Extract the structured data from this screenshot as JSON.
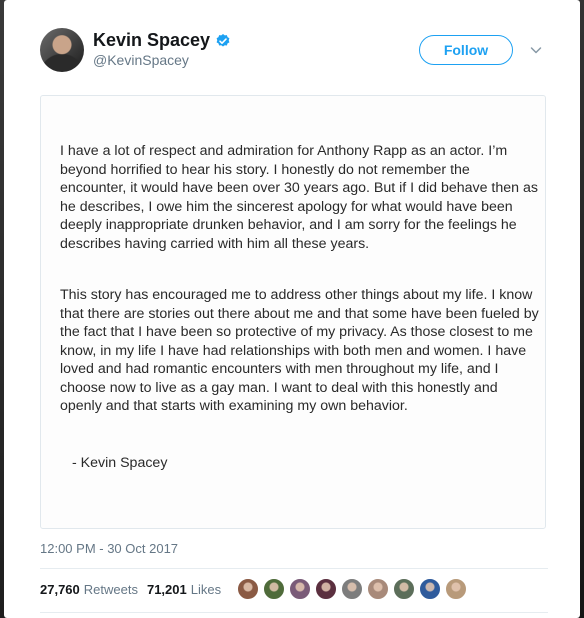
{
  "header": {
    "display_name": "Kevin Spacey",
    "handle": "@KevinSpacey",
    "follow_label": "Follow"
  },
  "statement": {
    "paragraph_1": "I have a lot of respect and admiration for Anthony Rapp as an actor. I’m beyond horrified to hear his story. I honestly do not remember the encounter, it would have been over 30 years ago. But if I did behave then as he describes, I owe him the sincerest apology for what would have been deeply inappropriate drunken behavior, and I am sorry for the feelings he describes having carried with him all these years.",
    "paragraph_2": "This story has encouraged me to address other things about my life. I know that there are stories out there about me and that some have been fueled by the fact that I have been so protective of my privacy. As those closest to me know, in my life I have had relationships with both men and women. I have loved and had romantic encounters with men throughout my life, and I choose now to live as a gay man.  I want to deal with this honestly and openly and that starts with examining my own behavior.",
    "signature": "- Kevin Spacey"
  },
  "meta": {
    "timestamp": "12:00 PM - 30 Oct 2017",
    "retweets_count": "27,760",
    "retweets_label": "Retweets",
    "likes_count": "71,201",
    "likes_label": "Likes"
  },
  "icons": {
    "verified": "verified-badge-icon",
    "caret": "chevron-down-icon"
  },
  "colors": {
    "accent": "#1da1f2",
    "text": "#14171a",
    "muted": "#657786"
  },
  "likers": [
    {
      "color": "#8a5a44"
    },
    {
      "color": "#4f6b3a"
    },
    {
      "color": "#7a5b78"
    },
    {
      "color": "#5b2f3f"
    },
    {
      "color": "#7d7d7d"
    },
    {
      "color": "#a88a7a"
    },
    {
      "color": "#5c6e5a"
    },
    {
      "color": "#2f5b9c"
    },
    {
      "color": "#b89a7a"
    }
  ]
}
